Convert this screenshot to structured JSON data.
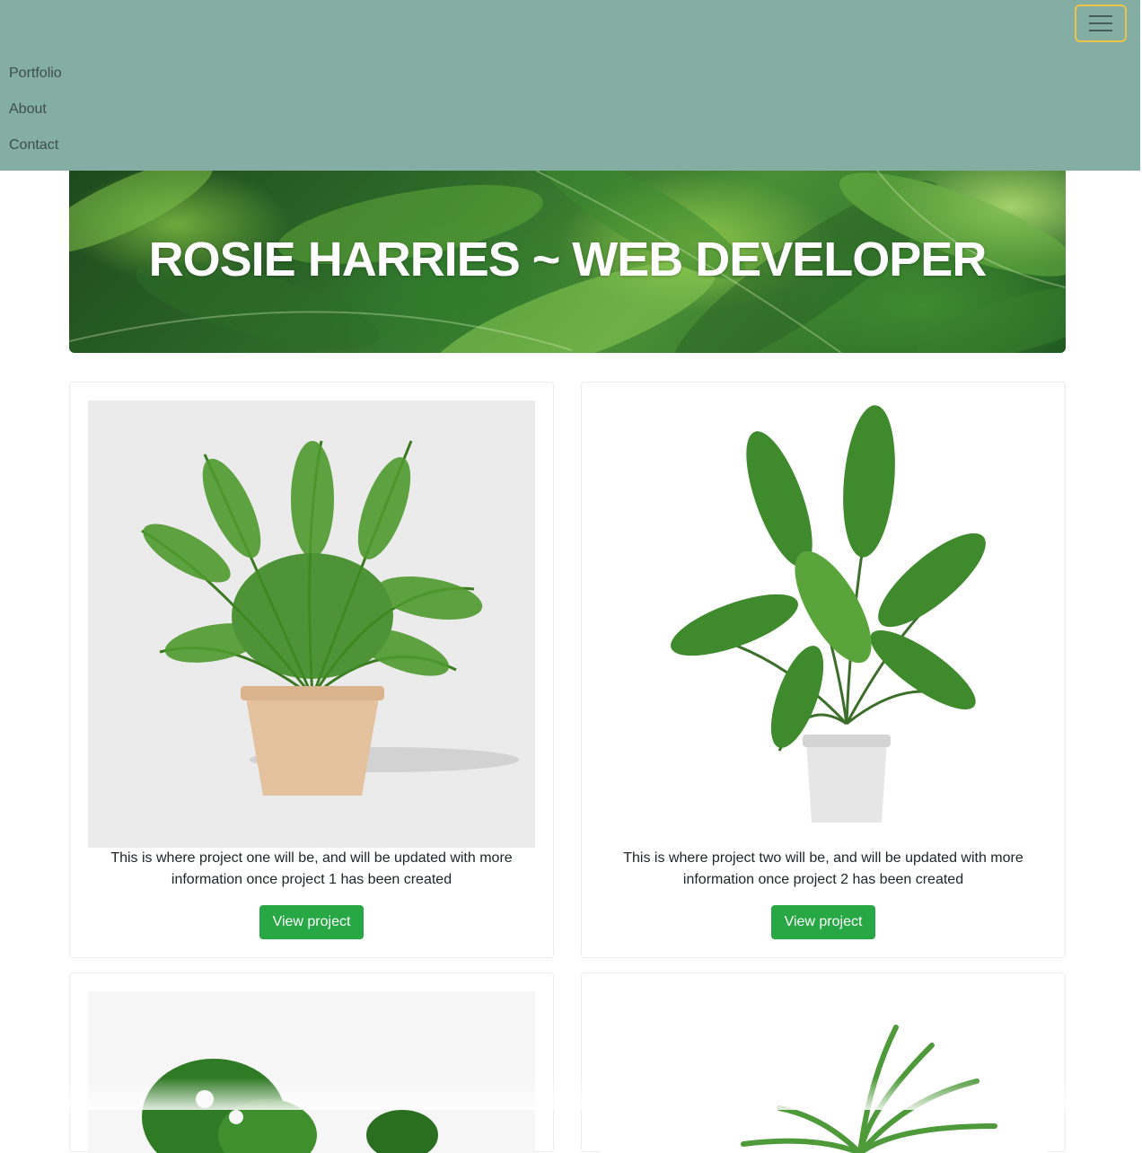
{
  "navbar": {
    "bg_color": "#84ada3",
    "toggler_icon": "hamburger-menu-icon",
    "items": [
      {
        "label": "Portfolio"
      },
      {
        "label": "About"
      },
      {
        "label": "Contact"
      }
    ]
  },
  "hero": {
    "title": "ROSIE HARRIES ~ WEB DEVELOPER"
  },
  "projects": [
    {
      "image": "potted-fern-image",
      "description": "This is where project one will be, and will be updated with more information once project 1 has been created",
      "button_label": "View project"
    },
    {
      "image": "potted-banana-plant-image",
      "description": "This is where project two will be, and will be updated with more information once project 2 has been created",
      "button_label": "View project"
    },
    {
      "image": "monstera-plant-image"
    },
    {
      "image": "palm-plant-image"
    }
  ],
  "colors": {
    "accent_button": "#28a745",
    "toggler_border": "#f0c24a"
  }
}
